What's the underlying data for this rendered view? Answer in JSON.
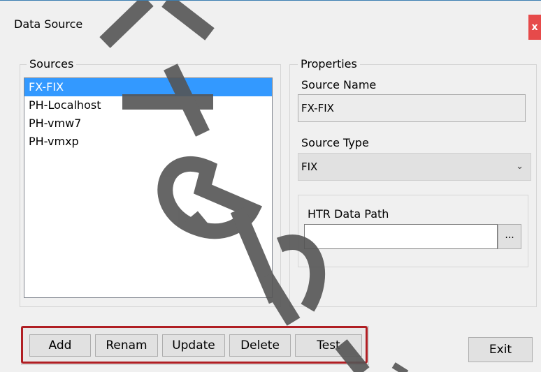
{
  "window": {
    "title": "Data Source",
    "close_label": "x"
  },
  "sources": {
    "group_label": "Sources",
    "items": [
      {
        "label": "FX-FIX",
        "selected": true
      },
      {
        "label": "PH-Localhost",
        "selected": false
      },
      {
        "label": "PH-vmw7",
        "selected": false
      },
      {
        "label": "PH-vmxp",
        "selected": false
      }
    ]
  },
  "properties": {
    "group_label": "Properties",
    "source_name_label": "Source Name",
    "source_name_value": "FX-FIX",
    "source_type_label": "Source Type",
    "source_type_value": "FIX",
    "htr_label": "HTR Data Path",
    "htr_value": "",
    "browse_label": "..."
  },
  "buttons": {
    "add": "Add",
    "rename": "Renam",
    "update": "Update",
    "delete": "Delete",
    "test": "Test",
    "exit": "Exit"
  },
  "colors": {
    "selection": "#3399ff",
    "highlight_outline": "#b01e23",
    "close_button": "#e64a4a"
  }
}
